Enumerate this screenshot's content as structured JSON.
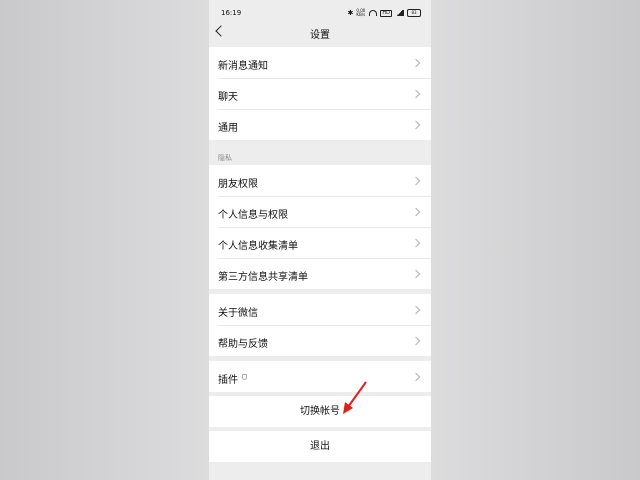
{
  "statusbar": {
    "time": "16:19",
    "network_speed": "0.00 KB/s",
    "hd_label": "HD",
    "battery": "83"
  },
  "navbar": {
    "title": "设置"
  },
  "groups": {
    "notifications": {
      "label": "新消息通知"
    },
    "chat": {
      "label": "聊天"
    },
    "general": {
      "label": "通用"
    }
  },
  "privacy": {
    "header": "隐私",
    "items": [
      "朋友权限",
      "个人信息与权限",
      "个人信息收集清单",
      "第三方信息共享清单"
    ]
  },
  "about": {
    "items": [
      "关于微信",
      "帮助与反馈"
    ]
  },
  "plugins": {
    "label": "插件"
  },
  "actions": {
    "switch_account": "切换帐号",
    "logout": "退出"
  },
  "colors": {
    "background": "#ededed",
    "arrow": "#e0201b"
  }
}
